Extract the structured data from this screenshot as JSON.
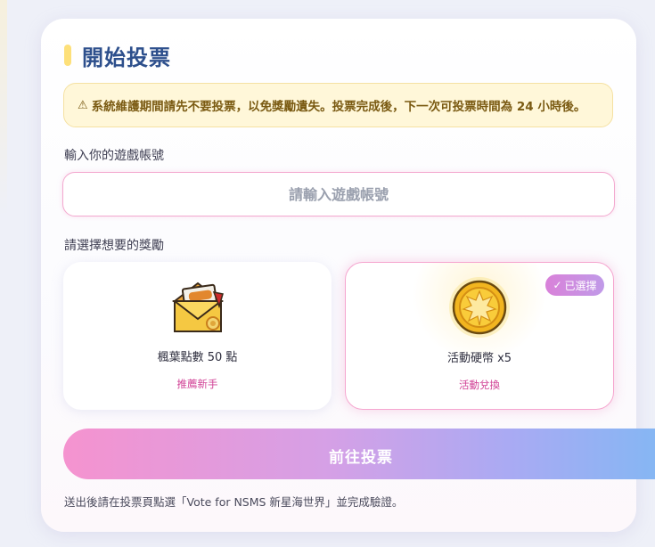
{
  "title": "開始投票",
  "warning": {
    "icon": "warning-icon",
    "text": "系統維護期間請先不要投票，以免獎勵遺失。投票完成後，下一次可投票時間為 24 小時後。"
  },
  "account": {
    "label": "輸入你的遊戲帳號",
    "placeholder": "請輸入遊戲帳號",
    "value": ""
  },
  "rewards": {
    "label": "請選擇想要的獎勵",
    "items": [
      {
        "name": "楓葉點數 50 點",
        "tag": "推薦新手",
        "icon": "maple-points-envelope-icon",
        "selected": false
      },
      {
        "name": "活動硬幣 x5",
        "tag": "活動兌換",
        "icon": "event-coin-icon",
        "selected": true,
        "badge": "已選擇"
      }
    ]
  },
  "vote_button": "前往投票",
  "footnote": "送出後請在投票頁點選「Vote for NSMS 新星海世界」並完成驗證。",
  "colors": {
    "title": "#2d4f8c",
    "accent_pink": "#f593cf",
    "accent_blue": "#86b6f3",
    "tag": "#d03f94",
    "warning_bg": "#fff7d9"
  }
}
